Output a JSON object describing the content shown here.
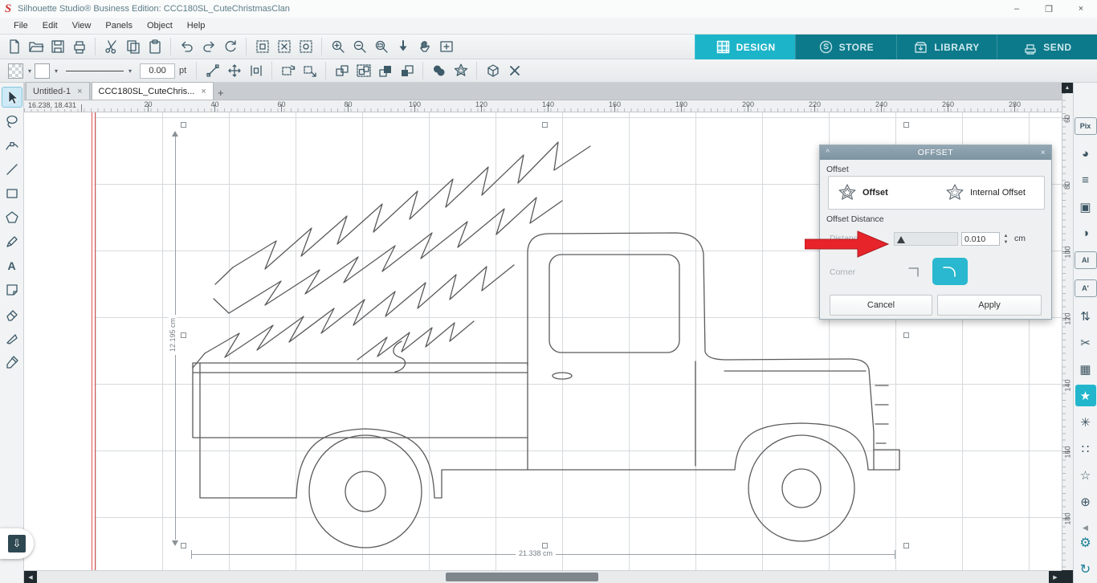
{
  "window": {
    "logo": "S",
    "title": "Silhouette Studio® Business Edition: CCC180SL_CuteChristmasClan",
    "minimize": "–",
    "maximize": "❒",
    "close": "×"
  },
  "menu": {
    "items": [
      "File",
      "Edit",
      "View",
      "Panels",
      "Object",
      "Help"
    ]
  },
  "nav": {
    "design": "DESIGN",
    "store": "STORE",
    "library": "LIBRARY",
    "send": "SEND",
    "active_tab": "DESIGN",
    "accent_color": "#1cb4c9",
    "bar_color": "#0c7a8a"
  },
  "toolbar2": {
    "stroke_width": "0.00",
    "unit": "pt"
  },
  "doc_tabs": {
    "tabs": [
      {
        "label": "Untitled-1"
      },
      {
        "label": "CCC180SL_CuteChris..."
      }
    ],
    "active_tab": "CCC180SL_CuteChris...",
    "close_glyph": "×",
    "new_tab_glyph": "+"
  },
  "rulers": {
    "cursor_position": "16.238, 18.431",
    "h_labels": [
      "20",
      "40",
      "60",
      "80",
      "100",
      "120",
      "140",
      "160",
      "180",
      "200",
      "220",
      "240",
      "260",
      "280"
    ],
    "v_labels": [
      "60",
      "80",
      "100",
      "120",
      "140",
      "160",
      "180"
    ]
  },
  "selection": {
    "width_label": "21.338 cm",
    "height_label": "12.195 cm"
  },
  "offset_panel": {
    "title": "OFFSET",
    "collapse_glyph": "^",
    "close_glyph": "×",
    "group_label": "Offset",
    "option_offset": "Offset",
    "option_internal": "Internal Offset",
    "distance_group_label": "Offset Distance",
    "distance_label": "Distance",
    "distance_value": "0.010",
    "spin_up": "▲",
    "spin_down": "▼",
    "unit": "cm",
    "corner_label": "Corner",
    "cancel_label": "Cancel",
    "apply_label": "Apply",
    "accent": "#29b8cf"
  },
  "right_panel": {
    "items": [
      {
        "name": "pixscan",
        "glyph": "Pix"
      },
      {
        "name": "color",
        "glyph": "◕"
      },
      {
        "name": "line-style",
        "glyph": "≡"
      },
      {
        "name": "trace",
        "glyph": "▣"
      },
      {
        "name": "shade",
        "glyph": "◑"
      },
      {
        "name": "text-style",
        "glyph": "Al"
      },
      {
        "name": "character",
        "glyph": "A'"
      },
      {
        "name": "transform",
        "glyph": "⇅"
      },
      {
        "name": "modify",
        "glyph": "✂"
      },
      {
        "name": "replicate",
        "glyph": "▦"
      },
      {
        "name": "offset",
        "glyph": "★"
      },
      {
        "name": "emboss",
        "glyph": "✳"
      },
      {
        "name": "rhinestone",
        "glyph": "∷"
      },
      {
        "name": "sketch",
        "glyph": "☆"
      },
      {
        "name": "puzzle",
        "glyph": "⊕"
      }
    ],
    "collapse_glyph": "◀",
    "settings_glyph": "⚙",
    "refresh_glyph": "↻"
  },
  "scroll": {
    "up": "▲",
    "left": "◀",
    "right": "▶"
  },
  "drawer": {
    "export_glyph": "⇩"
  },
  "tools_text": {
    "text_tool": "A"
  },
  "colors": {
    "arrow_red": "#e8242b",
    "grid": "#d6dadd",
    "page_margin_red": "#dd5050"
  }
}
